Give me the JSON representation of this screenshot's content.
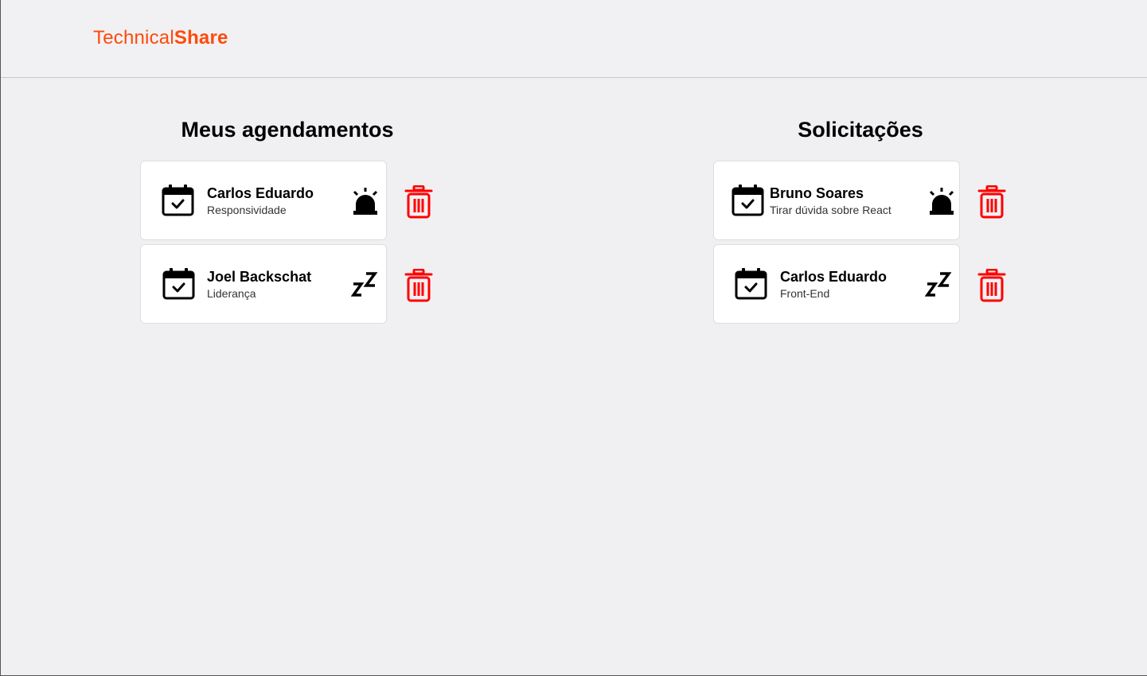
{
  "brand": {
    "part1": "Technical",
    "part2": "Share",
    "color": "#ff4a0b"
  },
  "sections": {
    "left": {
      "title": "Meus agendamentos"
    },
    "right": {
      "title": "Solicitações"
    }
  },
  "cards": {
    "left": [
      {
        "name": "Carlos Eduardo",
        "topic": "Responsividade",
        "status_icon": "alarm-icon"
      },
      {
        "name": "Joel Backschat",
        "topic": "Liderança",
        "status_icon": "sleep-icon"
      }
    ],
    "right": [
      {
        "name": "Bruno Soares",
        "topic": "Tirar dúvida sobre React",
        "status_icon": "alarm-icon"
      },
      {
        "name": "Carlos Eduardo",
        "topic": "Front-End",
        "status_icon": "sleep-icon"
      }
    ]
  },
  "colors": {
    "delete": "#ff0000",
    "background": "#f0f0f2"
  }
}
